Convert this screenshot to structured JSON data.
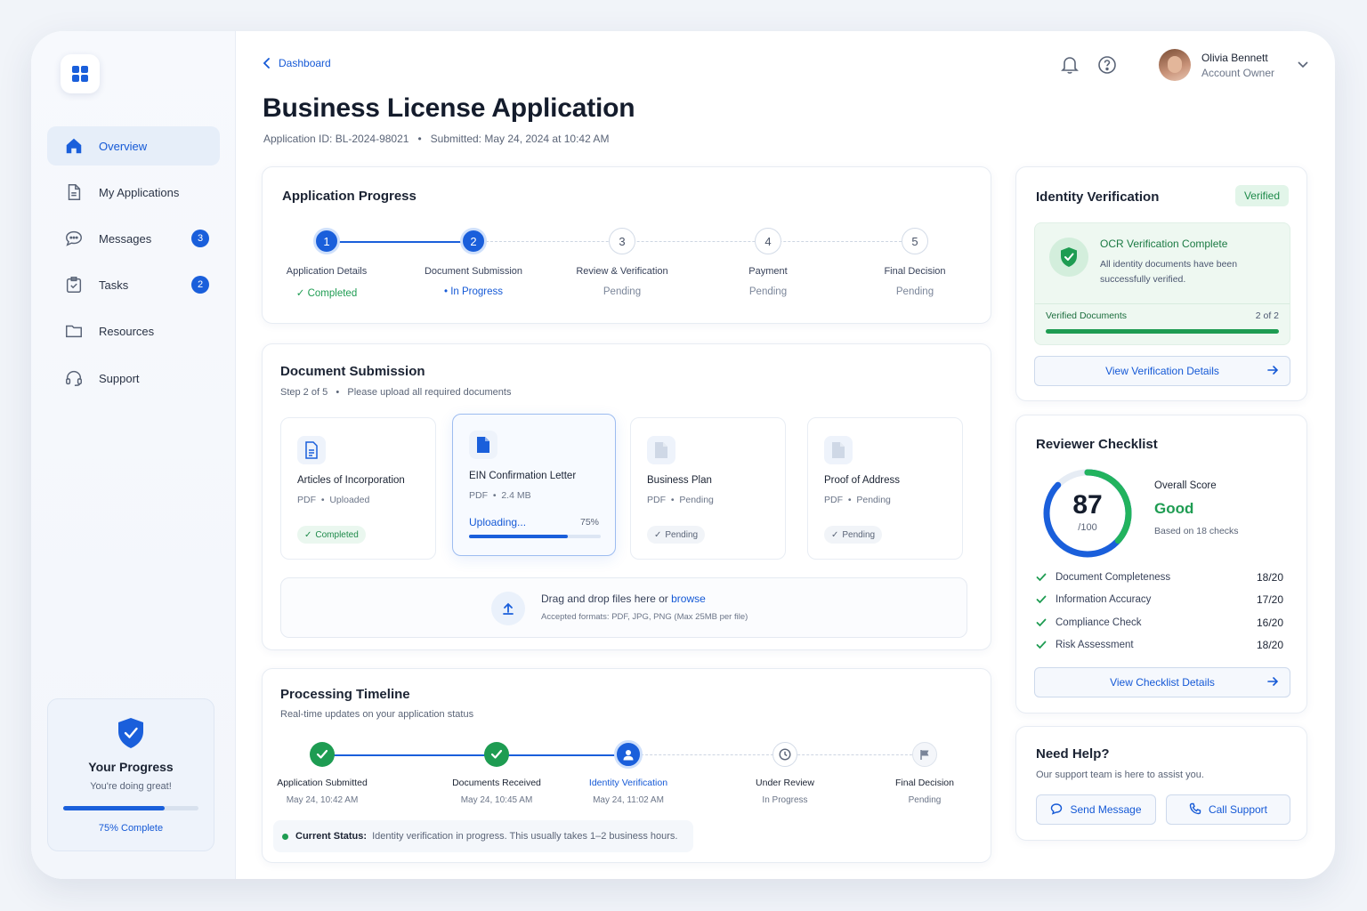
{
  "sidebar": {
    "items": [
      {
        "label": "Overview",
        "icon": "home-icon",
        "active": true
      },
      {
        "label": "My Applications",
        "icon": "document-icon"
      },
      {
        "label": "Messages",
        "icon": "chat-icon",
        "badge": "3"
      },
      {
        "label": "Tasks",
        "icon": "clipboard-check-icon",
        "badge": "2"
      },
      {
        "label": "Resources",
        "icon": "folder-icon"
      },
      {
        "label": "Support",
        "icon": "headset-icon"
      }
    ],
    "progress": {
      "title": "Your Progress",
      "subtitle": "You're doing great!",
      "percent_label": "75% Complete",
      "value": 0.75
    }
  },
  "header": {
    "breadcrumb": "Dashboard",
    "title": "Business License Application",
    "meta": "Application ID: BL-2024-98021   •   Submitted: May 24, 2024 at 10:42 AM",
    "user": {
      "name": "Olivia Bennett",
      "role": "Account Owner"
    }
  },
  "app_progress": {
    "title": "Application Progress",
    "steps": [
      {
        "num": "1",
        "label": "Application Details",
        "status": "Completed"
      },
      {
        "num": "2",
        "label": "Document Submission",
        "status": "In Progress"
      },
      {
        "num": "3",
        "label": "Review & Verification",
        "status": "Pending"
      },
      {
        "num": "4",
        "label": "Payment",
        "status": "Pending"
      },
      {
        "num": "5",
        "label": "Final Decision",
        "status": "Pending"
      }
    ]
  },
  "documents": {
    "title": "Document Submission",
    "subtitle": "Step 2 of 5   •   Please upload all required documents",
    "items": [
      {
        "name": "Articles of Incorporation",
        "meta": "PDF  •  Uploaded",
        "status": "Completed"
      },
      {
        "name": "EIN Confirmation Letter",
        "meta": "PDF  •  2.4 MB",
        "upload_label": "Uploading...",
        "upload_percent": "75%",
        "upload_value": 0.75
      },
      {
        "name": "Business Plan",
        "meta": "PDF  •  Pending",
        "status": "Pending"
      },
      {
        "name": "Proof of Address",
        "meta": "PDF  •  Pending",
        "status": "Pending"
      }
    ],
    "dropzone": {
      "text": "Drag and drop files here or ",
      "link": "browse",
      "formats": "Accepted formats: PDF, JPG, PNG (Max 25MB per file)"
    }
  },
  "timeline": {
    "title": "Processing Timeline",
    "subtitle": "Real-time updates on your application status",
    "items": [
      {
        "label": "Application Submitted",
        "sub": "May 24, 10:42 AM"
      },
      {
        "label": "Documents Received",
        "sub": "May 24, 10:45 AM"
      },
      {
        "label": "Identity Verification",
        "sub": "May 24, 11:02 AM"
      },
      {
        "label": "Under Review",
        "sub": "In Progress"
      },
      {
        "label": "Final Decision",
        "sub": "Pending"
      }
    ],
    "status_label": "Current Status:",
    "status_text": "Identity verification in progress. This usually takes 1–2 business hours."
  },
  "identity": {
    "title": "Identity Verification",
    "badge": "Verified",
    "ocr_title": "OCR Verification Complete",
    "ocr_text": "All identity documents have been successfully verified.",
    "docs_label": "Verified Documents",
    "docs_count": "2 of 2",
    "button": "View Verification Details"
  },
  "checklist": {
    "title": "Reviewer Checklist",
    "score": "87",
    "score_max": "/100",
    "score_value": 0.87,
    "overall_label": "Overall Score",
    "rating": "Good",
    "based_on": "Based on 18 checks",
    "rows": [
      {
        "label": "Document Completeness",
        "score": "18/20"
      },
      {
        "label": "Information Accuracy",
        "score": "17/20"
      },
      {
        "label": "Compliance Check",
        "score": "16/20"
      },
      {
        "label": "Risk Assessment",
        "score": "18/20"
      }
    ],
    "button": "View Checklist Details"
  },
  "help": {
    "title": "Need Help?",
    "subtitle": "Our support team is here to assist you.",
    "send_button": "Send Message",
    "call_button": "Call Support"
  },
  "colors": {
    "primary": "#1a5fdb",
    "success": "#1e9c52",
    "text": "#1b2333"
  }
}
